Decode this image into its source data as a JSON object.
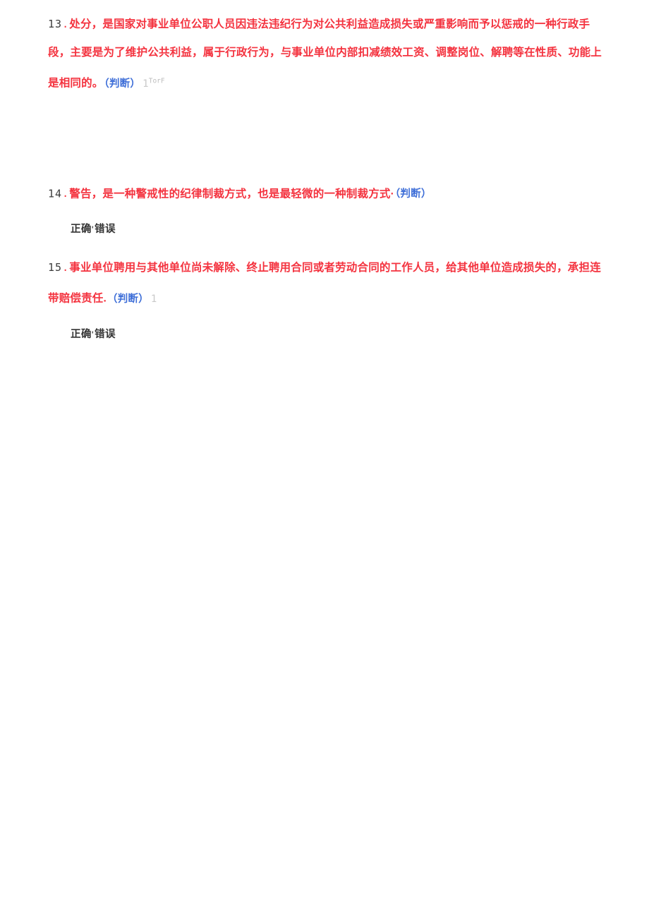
{
  "document": {
    "type": "quiz-worksheet",
    "colors": {
      "question_red": "#f4333f",
      "tag_blue": "#3f6fd8",
      "meta_gray": "#c9c9c9",
      "option_text": "#333333",
      "number_gray": "#3c3c3c",
      "background": "#ffffff"
    }
  },
  "questions": [
    {
      "number": "13",
      "dot": ".",
      "text": "处分，是国家对事业单位公职人员因违法违纪行为对公共利益造成损失或严重影响而予以惩戒的一种行政手段，主要是为了维护公共利益，属于行政行为，与事业单位内部扣减绩效工资、调整岗位、解聘等在性质、功能上是相同的。",
      "tag": "（判断）",
      "meta_number": "1",
      "meta_sup": "TorF",
      "has_options": false
    },
    {
      "number": "14",
      "dot": ".",
      "text": "警告，是一种警戒性的纪律制裁方式，也是最轻微的一种制裁方式·",
      "tag": "（判断）",
      "meta_number": "",
      "meta_sup": "",
      "has_options": true,
      "options": {
        "correct": "正确",
        "separator": "'",
        "wrong": "错误"
      }
    },
    {
      "number": "15",
      "dot": ".",
      "text": "事业单位聘用与其他单位尚未解除、终止聘用合同或者劳动合同的工作人员，给其他单位造成损失的，承担连带赔偿责任.",
      "tag": "（判断）",
      "meta_number": "1",
      "meta_sup": "",
      "has_options": true,
      "options": {
        "correct": "正确",
        "separator": "'",
        "wrong": "错误"
      }
    }
  ]
}
